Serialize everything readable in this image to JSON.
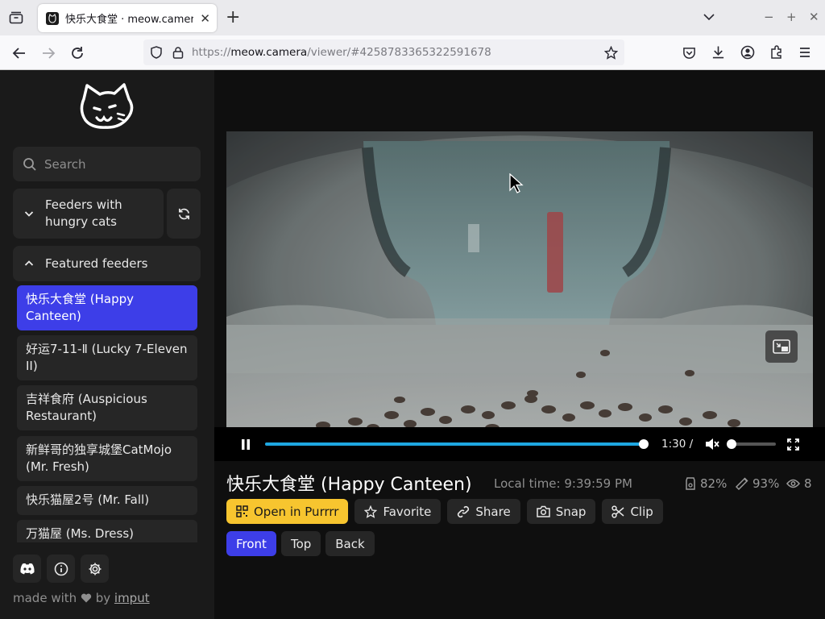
{
  "browser": {
    "tab_title": "快乐大食堂 · meow.camera",
    "url_host": "meow.camera",
    "url_prefix": "https://",
    "url_path": "/viewer/#4258783365322591678"
  },
  "sidebar": {
    "search_placeholder": "Search",
    "group_hungry": "Feeders with hungry cats",
    "group_featured": "Featured feeders",
    "feeders": [
      {
        "label": "快乐大食堂 (Happy Canteen)",
        "active": true
      },
      {
        "label": "好运7-11-Ⅱ (Lucky 7-Eleven II)"
      },
      {
        "label": "吉祥食府 (Auspicious Restaurant)"
      },
      {
        "label": "新鲜哥的独享城堡CatMojo (Mr. Fresh)"
      },
      {
        "label": "快乐猫屋2号 (Mr. Fall)"
      },
      {
        "label": "万猫屋 (Ms. Dress)"
      }
    ],
    "footer_made": "made with",
    "footer_by": "by",
    "footer_link": "imput"
  },
  "player": {
    "time": "1:30 /",
    "progress_fraction": 0.99,
    "volume_fraction": 0.0
  },
  "feeder_info": {
    "title": "快乐大食堂 (Happy Canteen)",
    "local_time": "Local time: 9:39:59 PM",
    "food": "82%",
    "battery": "93%",
    "viewers": "8"
  },
  "actions": {
    "open": "Open in Purrrr",
    "favorite": "Favorite",
    "share": "Share",
    "snap": "Snap",
    "clip": "Clip"
  },
  "cameras": [
    "Front",
    "Top",
    "Back"
  ],
  "colors": {
    "accent": "#3d3ee8",
    "primary_button": "#f7c52f",
    "progress": "#1ea7e1"
  }
}
